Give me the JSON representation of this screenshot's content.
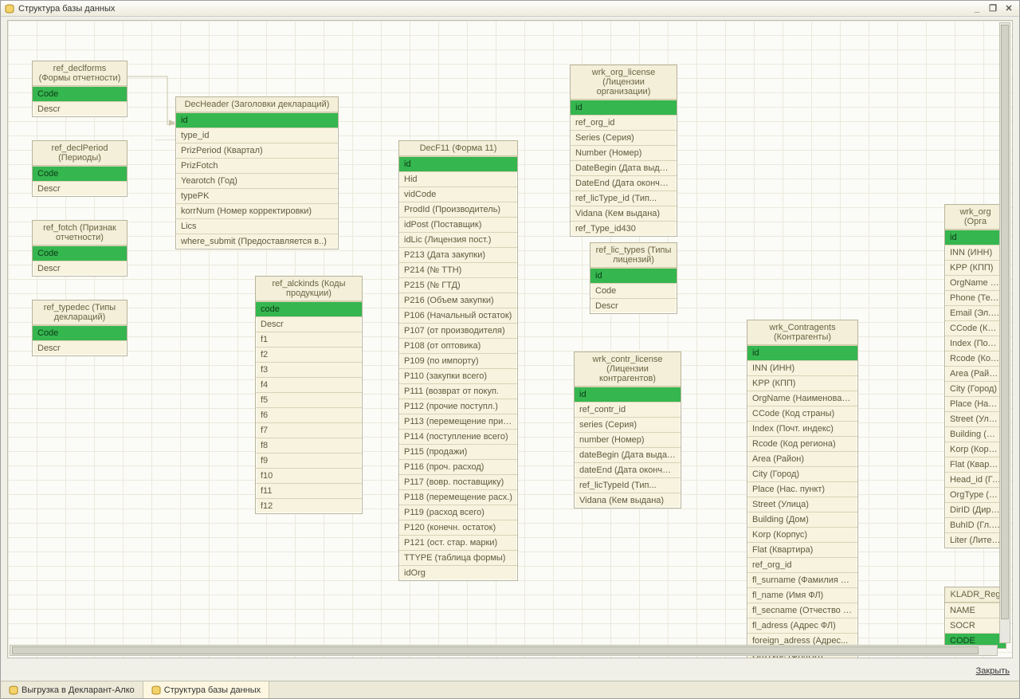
{
  "window": {
    "title": "Структура базы данных"
  },
  "buttons": {
    "min": "_",
    "restore": "❐",
    "close": "✕"
  },
  "close_link": "Закрыть",
  "taskbar": {
    "tab1": "Выгрузка в Декларант-Алко",
    "tab2": "Структура базы данных"
  },
  "tables": {
    "ref_declforms": {
      "title": "ref_declforms\n(Формы отчетности)",
      "rows": [
        [
          "Code",
          true
        ],
        [
          "Descr",
          false
        ]
      ]
    },
    "ref_declPeriod": {
      "title": "ref_declPeriod\n(Периоды)",
      "rows": [
        [
          "Code",
          true
        ],
        [
          "Descr",
          false
        ]
      ]
    },
    "ref_fotch": {
      "title": "ref_fotch (Признак\nотчетности)",
      "rows": [
        [
          "Code",
          true
        ],
        [
          "Descr",
          false
        ]
      ]
    },
    "ref_typedec": {
      "title": "ref_typedec (Типы\nдеклараций)",
      "rows": [
        [
          "Code",
          true
        ],
        [
          "Descr",
          false
        ]
      ]
    },
    "DecHeader": {
      "title": "DecHeader (Заголовки деклараций)",
      "rows": [
        [
          "id",
          true
        ],
        [
          "type_id",
          false
        ],
        [
          "PrizPeriod (Квартал)",
          false
        ],
        [
          "PrizFotch",
          false
        ],
        [
          "Yearotch (Год)",
          false
        ],
        [
          "typePK",
          false
        ],
        [
          "korrNum (Номер корректировки)",
          false
        ],
        [
          "Lics",
          false
        ],
        [
          "where_submit (Предоставляется в..)",
          false
        ]
      ]
    },
    "ref_alckinds": {
      "title": "ref_alckinds (Коды\nпродукции)",
      "rows": [
        [
          "code",
          true
        ],
        [
          "Descr",
          false
        ],
        [
          "f1",
          false
        ],
        [
          "f2",
          false
        ],
        [
          "f3",
          false
        ],
        [
          "f4",
          false
        ],
        [
          "f5",
          false
        ],
        [
          "f6",
          false
        ],
        [
          "f7",
          false
        ],
        [
          "f8",
          false
        ],
        [
          "f9",
          false
        ],
        [
          "f10",
          false
        ],
        [
          "f11",
          false
        ],
        [
          "f12",
          false
        ]
      ]
    },
    "DecF11": {
      "title": "DecF11 (Форма 11)",
      "rows": [
        [
          "id",
          true
        ],
        [
          "Hid",
          false
        ],
        [
          "vidCode",
          false
        ],
        [
          "ProdId (Производитель)",
          false
        ],
        [
          "idPost (Поставщик)",
          false
        ],
        [
          "idLic (Лицензия пост.)",
          false
        ],
        [
          "P213 (Дата закупки)",
          false
        ],
        [
          "P214 (№ ТТН)",
          false
        ],
        [
          "P215 (№ ГТД)",
          false
        ],
        [
          "P216 (Объем закупки)",
          false
        ],
        [
          "P106 (Начальный остаток)",
          false
        ],
        [
          "P107 (от производителя)",
          false
        ],
        [
          "P108 (от оптовика)",
          false
        ],
        [
          "P109 (по импорту)",
          false
        ],
        [
          "P110 (закупки всего)",
          false
        ],
        [
          "P111 (возврат от покуп.",
          false
        ],
        [
          "P112 (прочие поступл.)",
          false
        ],
        [
          "P113 (перемещение прих.)",
          false
        ],
        [
          "P114 (поступление всего)",
          false
        ],
        [
          "P115 (продажи)",
          false
        ],
        [
          "P116 (проч. расход)",
          false
        ],
        [
          "P117 (вовр. поставщику)",
          false
        ],
        [
          "P118 (перемещение расх.)",
          false
        ],
        [
          "P119 (расход всего)",
          false
        ],
        [
          "P120 (конечн. остаток)",
          false
        ],
        [
          "P121 (ост. стар. марки)",
          false
        ],
        [
          "TTYPE (таблица формы)",
          false
        ],
        [
          "idOrg",
          false
        ]
      ]
    },
    "wrk_org_license": {
      "title": "wrk_org_license\n(Лицензии организации)",
      "rows": [
        [
          "id",
          true
        ],
        [
          "ref_org_id",
          false
        ],
        [
          "Series (Серия)",
          false
        ],
        [
          "Number (Номер)",
          false
        ],
        [
          "DateBegin (Дата выдачи)",
          false
        ],
        [
          "DateEnd (Дата окончания",
          false
        ],
        [
          "ref_licType_id  (Тип...",
          false
        ],
        [
          "Vidana (Кем выдана)",
          false
        ],
        [
          "ref_Type_id430",
          false
        ]
      ]
    },
    "ref_lic_types": {
      "title": "ref_lic_types (Типы\nлицензий)",
      "rows": [
        [
          "id",
          true
        ],
        [
          "Code",
          false
        ],
        [
          "Descr",
          false
        ]
      ]
    },
    "wrk_contr_license": {
      "title": "wrk_contr_license\n(Лицензии\nконтрагентов)",
      "rows": [
        [
          "id",
          true
        ],
        [
          "ref_contr_id",
          false
        ],
        [
          "series (Серия)",
          false
        ],
        [
          "number (Номер)",
          false
        ],
        [
          "dateBegin (Дата выдачи)",
          false
        ],
        [
          "dateEnd (Дата окончания)",
          false
        ],
        [
          "ref_licTypeId  (Тип...",
          false
        ],
        [
          "Vidana (Кем выдана)",
          false
        ]
      ]
    },
    "wrk_Contragents": {
      "title": "wrk_Contragents\n(Контрагенты)",
      "rows": [
        [
          "id",
          true
        ],
        [
          "INN (ИНН)",
          false
        ],
        [
          "KPP (КПП)",
          false
        ],
        [
          "OrgName (Наименование)",
          false
        ],
        [
          "CCode (Код страны)",
          false
        ],
        [
          "Index (Почт. индекс)",
          false
        ],
        [
          "Rcode (Код региона)",
          false
        ],
        [
          "Area (Район)",
          false
        ],
        [
          "City (Город)",
          false
        ],
        [
          "Place (Нас. пункт)",
          false
        ],
        [
          "Street (Улица)",
          false
        ],
        [
          "Building (Дом)",
          false
        ],
        [
          "Korp (Корпус)",
          false
        ],
        [
          "Flat (Квартира)",
          false
        ],
        [
          "ref_org_id",
          false
        ],
        [
          "fl_surname (Фамилия ФЛ)",
          false
        ],
        [
          "fl_name (Имя ФЛ)",
          false
        ],
        [
          "fl_secname (Отчество ФЛ)",
          false
        ],
        [
          "fl_adress (Адрес ФЛ)",
          false
        ],
        [
          "foreign_adress  (Адрес...",
          false
        ],
        [
          "OrgType (ФЛ/ЮЛ)",
          false
        ]
      ]
    },
    "wrk_org": {
      "title": "wrk_org (Орга",
      "rows": [
        [
          "id",
          true
        ],
        [
          "INN (ИНН)",
          false
        ],
        [
          "KPP (КПП)",
          false
        ],
        [
          "OrgName (Наим",
          false
        ],
        [
          "Phone (Телефо",
          false
        ],
        [
          "Email (Эл. почта",
          false
        ],
        [
          "CCode (Код стр",
          false
        ],
        [
          "Index (Почт. ин",
          false
        ],
        [
          "Rcode (Код рег",
          false
        ],
        [
          "Area (Район)",
          false
        ],
        [
          "City (Город)",
          false
        ],
        [
          "Place (Нас. пун",
          false
        ],
        [
          "Street (Улица)",
          false
        ],
        [
          "Building (Дом)",
          false
        ],
        [
          "Korp (Корпус)",
          false
        ],
        [
          "Flat (Квартира)",
          false
        ],
        [
          "Head_id (Голов",
          false
        ],
        [
          "OrgType (Физ./и",
          false
        ],
        [
          "DirID (Директор",
          false
        ],
        [
          "BuhID (Гл. бухга",
          false
        ],
        [
          "Liter (Литера)",
          false
        ]
      ]
    },
    "KLADR": {
      "title": "KLADR_Reg",
      "rows": [
        [
          "NAME",
          false
        ],
        [
          "SOCR",
          false
        ],
        [
          "CODE",
          true
        ]
      ]
    }
  }
}
